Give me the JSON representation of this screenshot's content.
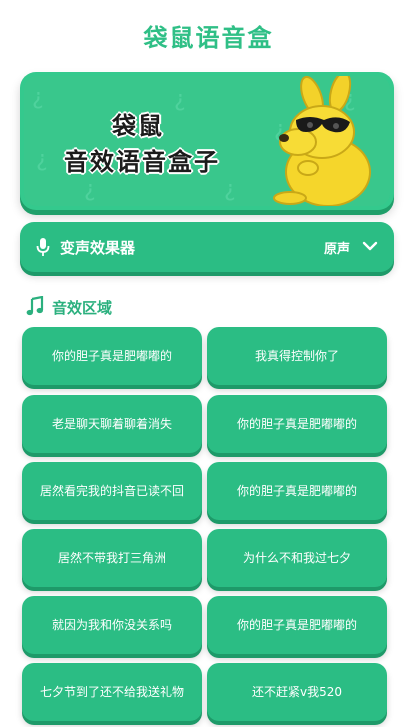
{
  "app": {
    "title": "袋鼠语音盒"
  },
  "banner": {
    "line1": "袋鼠",
    "line2": "音效语音盒子"
  },
  "voice_changer": {
    "label": "变声效果器",
    "value": "原声",
    "icon": "mic-icon"
  },
  "effects_section": {
    "label": "音效区域",
    "icon": "music-note-icon"
  },
  "sound_buttons": [
    "你的胆子真是肥嘟嘟的",
    "我真得控制你了",
    "老是聊天聊着聊着消失",
    "你的胆子真是肥嘟嘟的",
    "居然看完我的抖音已读不回",
    "你的胆子真是肥嘟嘟的",
    "居然不带我打三角洲",
    "为什么不和我过七夕",
    "就因为我和你没关系吗",
    "你的胆子真是肥嘟嘟的",
    "七夕节到了还不给我送礼物",
    "还不赶紧v我520"
  ],
  "colors": {
    "primary": "#2bbd84",
    "primary_dark": "#1e9a69",
    "title": "#2fbf86"
  }
}
